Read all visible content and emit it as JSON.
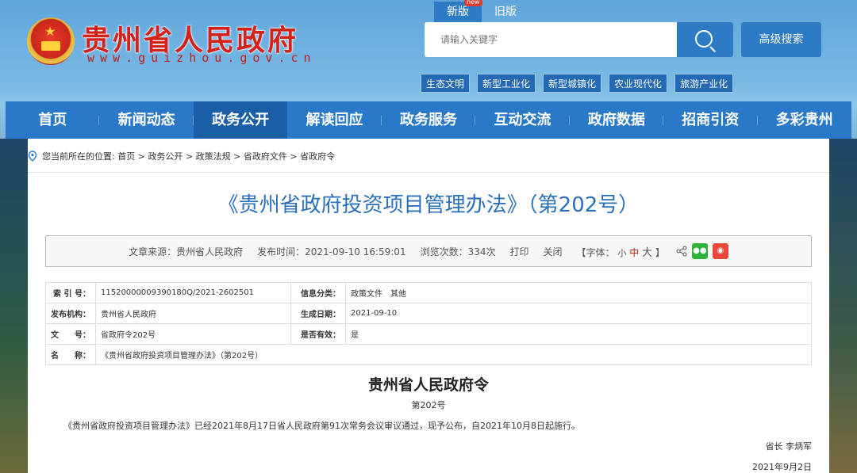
{
  "header": {
    "site_title": "贵州省人民政府",
    "site_domain": "www.guizhou.gov.cn",
    "version_tabs": [
      "新版",
      "旧版"
    ],
    "new_badge": "new",
    "search_placeholder": "请输入关键字",
    "advanced_search": "高级搜索",
    "tags": [
      "生态文明",
      "新型工业化",
      "新型城镇化",
      "农业现代化",
      "旅游产业化"
    ]
  },
  "nav": [
    "首页",
    "新闻动态",
    "政务公开",
    "解读回应",
    "政务服务",
    "互动交流",
    "政府数据",
    "招商引资",
    "多彩贵州"
  ],
  "nav_active": "政务公开",
  "breadcrumb": {
    "prefix": "您当前所在的位置:",
    "items": [
      "首页",
      "政务公开",
      "政策法规",
      "省政府文件",
      "省政府令"
    ],
    "separator": ">"
  },
  "article": {
    "title": "《贵州省政府投资项目管理办法》（第202号）",
    "meta": {
      "source": "文章来源：贵州省人民政府",
      "published": "发布时间：2021-09-10 16:59:01",
      "views": "浏览次数：334次",
      "print": "打印",
      "close": "关闭",
      "font_label": "【字体：",
      "font_small": "小",
      "font_mid": "中",
      "font_large": "大",
      "font_end": "】"
    },
    "info": [
      {
        "k1": "索 引 号：",
        "v1": "11520000009390180Q/2021-2602501",
        "k2": "信息分类：",
        "v2": "政策文件　其他"
      },
      {
        "k1": "发布机构：",
        "v1": "贵州省人民政府",
        "k2": "生成日期：",
        "v2": "2021-09-10"
      },
      {
        "k1": "文　　号：",
        "v1": "省政府令202号",
        "k2": "是否有效：",
        "v2": "是"
      },
      {
        "k1": "名　　称：",
        "v1": "《贵州省政府投资项目管理办法》（第202号）"
      }
    ],
    "order_title": "贵州省人民政府令",
    "order_no": "第202号",
    "body": "《贵州省政府投资项目管理办法》已经2021年8月17日省人民政府第91次常务会议审议通过，现予公布，自2021年10月8日起施行。",
    "signer": "省长 李炳军",
    "date": "2021年9月2日"
  },
  "colors": {
    "primary": "#2a78c8",
    "nav_active": "#1a5ea6",
    "title_red": "#d4221a",
    "article_title": "#2a6fb8"
  }
}
